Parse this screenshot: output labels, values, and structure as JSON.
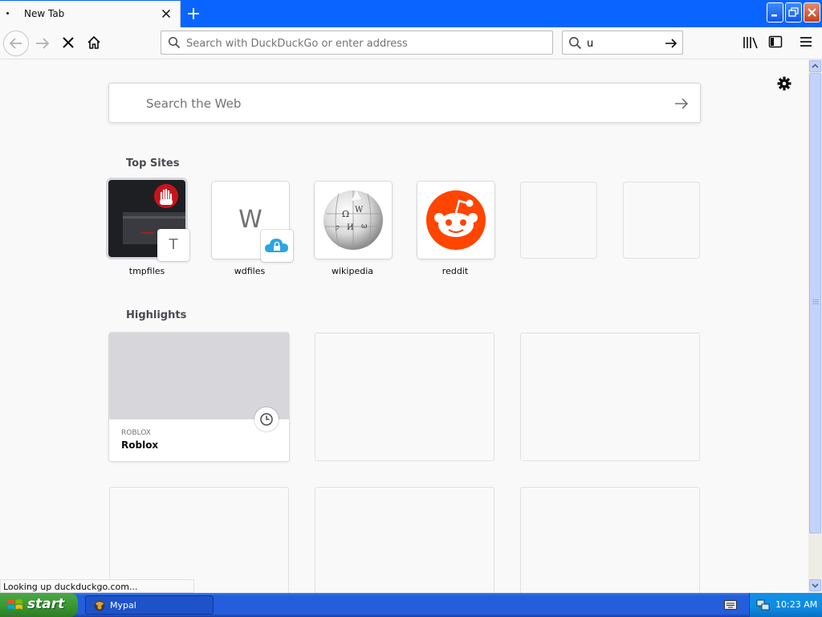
{
  "tab": {
    "title": "New Tab"
  },
  "toolbar": {
    "url_placeholder": "Search with DuckDuckGo or enter address",
    "search_value": "u"
  },
  "newtab": {
    "search_placeholder": "Search the Web",
    "top_sites_title": "Top Sites",
    "top_sites": [
      {
        "label": "tmpfiles",
        "badge_letter": "T"
      },
      {
        "label": "wdfiles",
        "letter": "W"
      },
      {
        "label": "wikipedia",
        "icon": "wikipedia-globe-icon"
      },
      {
        "label": "reddit",
        "icon": "reddit-alien-icon"
      },
      {
        "label": ""
      },
      {
        "label": ""
      }
    ],
    "highlights_title": "Highlights",
    "highlights": [
      {
        "host": "ROBLOX",
        "title": "Roblox"
      }
    ]
  },
  "status_text": "Looking up duckduckgo.com...",
  "taskbar": {
    "start_label": "start",
    "task_label": "Mypal",
    "clock": "10:23 AM"
  },
  "colors": {
    "titlebar": "#0a64ff",
    "reddit": "#ff4500",
    "tray": "#0d8ce3",
    "start": "#37952f"
  }
}
